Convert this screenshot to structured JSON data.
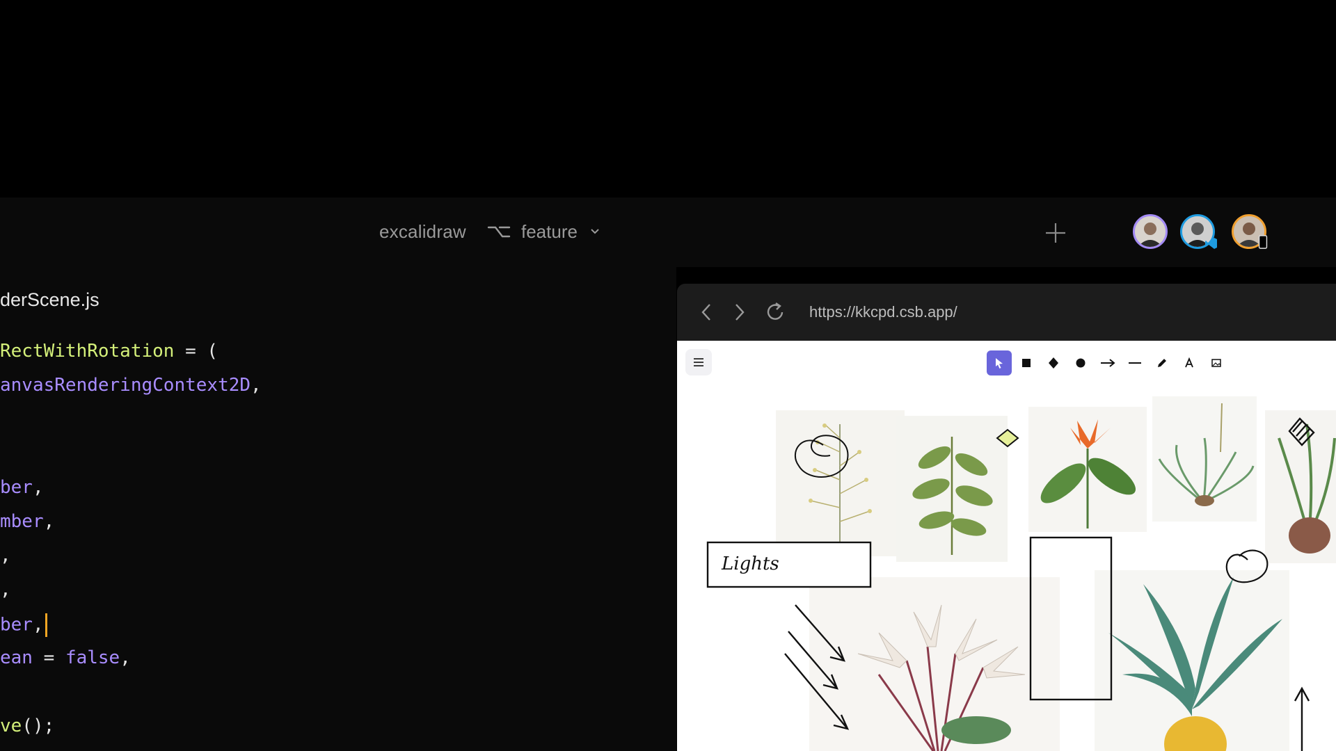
{
  "header": {
    "repo_name": "excalidraw",
    "branch_name": "feature"
  },
  "editor": {
    "filename": "derScene.js",
    "lines": [
      {
        "parts": [
          {
            "t": "RectWithRotation",
            "c": "fn"
          },
          {
            "t": " = (",
            "c": ""
          }
        ]
      },
      {
        "parts": [
          {
            "t": "anvasRenderingContext2D",
            "c": "ty"
          },
          {
            "t": ",",
            "c": ""
          }
        ]
      },
      {
        "parts": []
      },
      {
        "parts": [
          {
            "t": "ber",
            "c": "ty"
          },
          {
            "t": ",",
            "c": ""
          }
        ]
      },
      {
        "parts": [
          {
            "t": "mber",
            "c": "ty"
          },
          {
            "t": ",",
            "c": ""
          }
        ]
      },
      {
        "parts": [
          {
            "t": ",",
            "c": ""
          }
        ]
      },
      {
        "parts": [
          {
            "t": ",",
            "c": ""
          }
        ]
      },
      {
        "parts": [
          {
            "t": "ber",
            "c": "ty"
          },
          {
            "t": ",",
            "c": ""
          }
        ],
        "cursor": true
      },
      {
        "parts": [
          {
            "t": "ean",
            "c": "ty"
          },
          {
            "t": " = ",
            "c": ""
          },
          {
            "t": "false",
            "c": "kw"
          },
          {
            "t": ",",
            "c": ""
          }
        ]
      },
      {
        "parts": []
      },
      {
        "parts": [
          {
            "t": "ve",
            "c": "fn"
          },
          {
            "t": "();",
            "c": ""
          }
        ]
      }
    ]
  },
  "browser": {
    "url": "https://kkcpd.csb.app/"
  },
  "canvas": {
    "label_text": "Lights",
    "tools": [
      "selection-tool",
      "rectangle-tool",
      "diamond-tool",
      "ellipse-tool",
      "arrow-tool",
      "line-tool",
      "pencil-tool",
      "text-tool",
      "image-tool"
    ],
    "active_tool": "selection-tool"
  },
  "colors": {
    "accent": "#6965db",
    "function": "#d4f07a",
    "type": "#a98dff",
    "cursor": "#f5a623"
  }
}
